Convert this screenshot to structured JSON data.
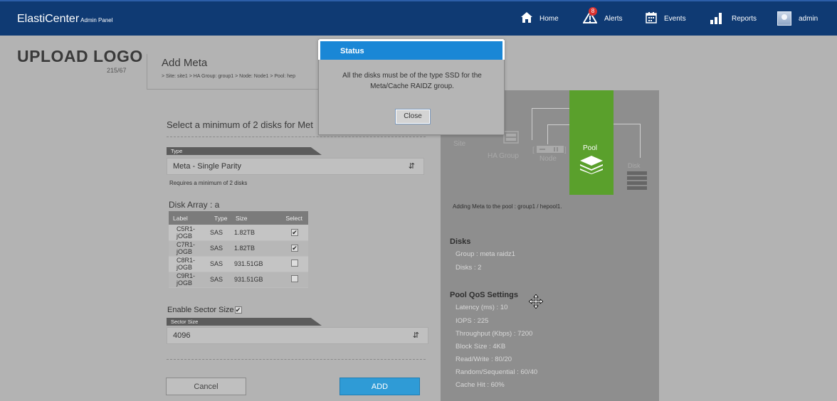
{
  "header": {
    "brand": "ElastiCenter",
    "brand_sub": "Admin Panel",
    "nav": [
      {
        "label": "Home",
        "icon": "home-icon"
      },
      {
        "label": "Alerts",
        "icon": "alert-triangle-icon",
        "badge": "8"
      },
      {
        "label": "Events",
        "icon": "calendar-icon"
      },
      {
        "label": "Reports",
        "icon": "bar-chart-icon"
      },
      {
        "label": "admin",
        "icon": "avatar-icon"
      }
    ]
  },
  "page": {
    "upload_logo": "UPLOAD LOGO",
    "upload_sub": "215/67",
    "title": "Add Meta",
    "breadcrumb": "> Site: site1 > HA Group: group1 > Node: Node1 > Pool: hep"
  },
  "form": {
    "select_heading": "Select a minimum of 2 disks for Met",
    "type_label": "Type",
    "type_value": "Meta - Single Parity",
    "type_hint": "Requires a minimum of 2 disks",
    "disk_array_title": "Disk Array : a",
    "columns": [
      "Label",
      "Type",
      "Size",
      "Select"
    ],
    "disks": [
      {
        "label": "C5R1-jOGB",
        "type": "SAS",
        "size": "1.82TB",
        "checked": true
      },
      {
        "label": "C7R1-jOGB",
        "type": "SAS",
        "size": "1.82TB",
        "checked": true
      },
      {
        "label": "C8R1-jOGB",
        "type": "SAS",
        "size": "931.51GB",
        "checked": false
      },
      {
        "label": "C9R1-jOGB",
        "type": "SAS",
        "size": "931.51GB",
        "checked": false
      }
    ],
    "enable_sector_label": "Enable Sector Size",
    "enable_sector_checked": true,
    "sector_size_label": "Sector Size",
    "sector_size_value": "4096",
    "cancel_label": "Cancel",
    "add_label": "ADD"
  },
  "diagram": {
    "site": "Site",
    "ha_group": "HA Group",
    "node": "Node",
    "pool": "Pool",
    "disk": "Disk"
  },
  "summary": {
    "adding_text": "Adding Meta to the pool : group1 / hepool1.",
    "disks_heading": "Disks",
    "group": "Group : meta raidz1",
    "disks_count": "Disks : 2",
    "qos_heading": "Pool QoS Settings",
    "latency": "Latency (ms) : 10",
    "iops": "IOPS : 225",
    "throughput": "Throughput (Kbps) : 7200",
    "block_size": "Block Size : 4KB",
    "read_write": "Read/Write : 80/20",
    "random_sequential": "Random/Sequential : 60/40",
    "cache_hit": "Cache Hit : 60%"
  },
  "modal": {
    "title": "Status",
    "message": "All the disks must be of the type SSD for the Meta/Cache RAIDZ group.",
    "close_label": "Close"
  },
  "colors": {
    "nav_bg": "#0f3a73",
    "pool_green": "#5aa02c",
    "modal_blue": "#1a87d6",
    "add_blue": "#2f9bd6"
  }
}
